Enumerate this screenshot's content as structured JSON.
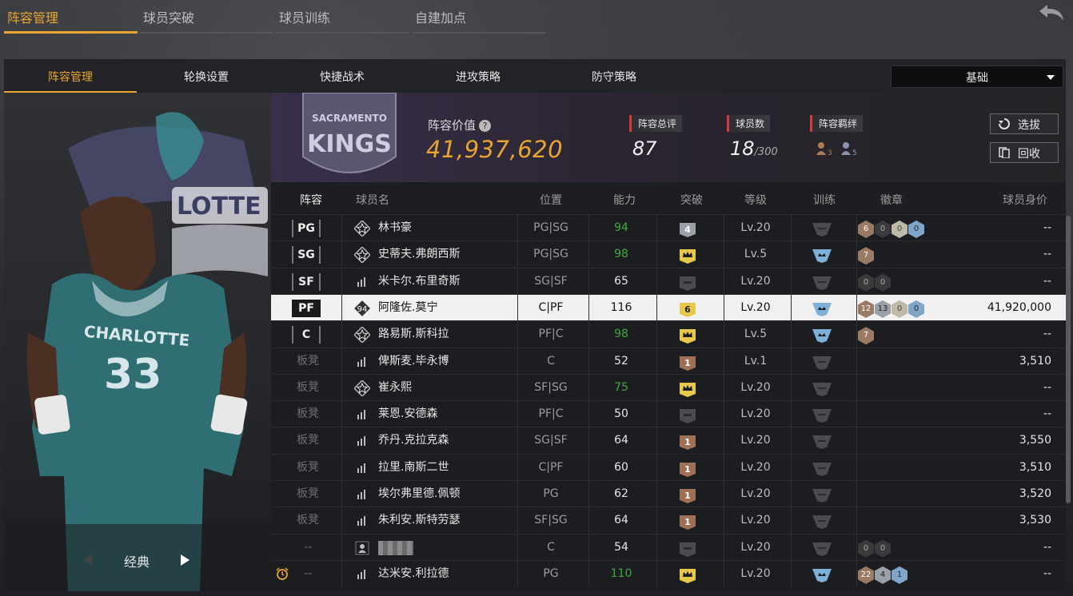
{
  "top_tabs": [
    {
      "label": "阵容管理",
      "active": true
    },
    {
      "label": "球员突破",
      "active": false
    },
    {
      "label": "球员训练",
      "active": false
    },
    {
      "label": "自建加点",
      "active": false
    }
  ],
  "sub_tabs": [
    {
      "label": "阵容管理",
      "active": true
    },
    {
      "label": "轮换设置",
      "active": false
    },
    {
      "label": "快捷战术",
      "active": false
    },
    {
      "label": "进攻策略",
      "active": false
    },
    {
      "label": "防守策略",
      "active": false
    }
  ],
  "dropdown": {
    "selected": "基础"
  },
  "portrait": {
    "style_label": "经典"
  },
  "team": {
    "logo_text_top": "SACRAMENTO",
    "logo_text_main": "KINGS",
    "value_label": "阵容价值",
    "value": "41,937,620",
    "rating_label": "阵容总评",
    "rating": "87",
    "players_label": "球员数",
    "players": "18",
    "players_max": "/300",
    "bond_label": "阵容羁绊",
    "bond_counts": [
      "3",
      "5"
    ],
    "pick_button": "选拔",
    "recycle_button": "回收"
  },
  "table": {
    "headers": [
      "阵容",
      "球员名",
      "位置",
      "能力",
      "突破",
      "等级",
      "训练",
      "徽章",
      "球员身价"
    ],
    "rows": [
      {
        "slot": "PG",
        "slot_type": "starter",
        "icon": "star",
        "name": "林书豪",
        "pos": "PG|SG",
        "ability": "94",
        "ability_green": true,
        "break": "4",
        "break_type": "silver",
        "level": "Lv.20",
        "train": "gray",
        "badges": [
          {
            "n": "6",
            "c": "bronze"
          },
          {
            "n": "0",
            "c": "empty"
          },
          {
            "n": "0",
            "c": "gold"
          },
          {
            "n": "0",
            "c": "blue"
          }
        ],
        "price": "--",
        "selected": false
      },
      {
        "slot": "SG",
        "slot_type": "starter",
        "icon": "star",
        "name": "史蒂夫.弗朗西斯",
        "pos": "PG|SG",
        "ability": "98",
        "ability_green": true,
        "break": "",
        "break_type": "crown",
        "level": "Lv.5",
        "train": "blue",
        "badges": [
          {
            "n": "7",
            "c": "bronze"
          }
        ],
        "price": "--",
        "selected": false
      },
      {
        "slot": "SF",
        "slot_type": "starter",
        "icon": "bars",
        "name": "米卡尔.布里奇斯",
        "pos": "SG|SF",
        "ability": "65",
        "ability_green": false,
        "break": "",
        "break_type": "none",
        "level": "Lv.20",
        "train": "gray",
        "badges": [
          {
            "n": "0",
            "c": "empty"
          },
          {
            "n": "0",
            "c": "empty"
          }
        ],
        "price": "--",
        "selected": false
      },
      {
        "slot": "PF",
        "slot_type": "starter",
        "icon": "94",
        "name": "阿隆佐.莫宁",
        "pos": "C|PF",
        "ability": "116",
        "ability_green": false,
        "break": "6",
        "break_type": "gold",
        "level": "Lv.20",
        "train": "blue",
        "badges": [
          {
            "n": "12",
            "c": "bronze"
          },
          {
            "n": "13",
            "c": "silver"
          },
          {
            "n": "0",
            "c": "gold"
          },
          {
            "n": "0",
            "c": "blue"
          }
        ],
        "price": "41,920,000",
        "selected": true
      },
      {
        "slot": "C",
        "slot_type": "starter",
        "icon": "star",
        "name": "路易斯.斯科拉",
        "pos": "PF|C",
        "ability": "98",
        "ability_green": true,
        "break": "",
        "break_type": "crown",
        "level": "Lv.5",
        "train": "blue",
        "badges": [
          {
            "n": "7",
            "c": "bronze"
          }
        ],
        "price": "--",
        "selected": false
      },
      {
        "slot": "板凳",
        "slot_type": "bench",
        "icon": "bars",
        "name": "俾斯麦.毕永博",
        "pos": "C",
        "ability": "52",
        "ability_green": false,
        "break": "1",
        "break_type": "bronze",
        "level": "Lv.1",
        "train": "gray",
        "badges": [],
        "price": "3,510",
        "selected": false
      },
      {
        "slot": "板凳",
        "slot_type": "bench",
        "icon": "star",
        "name": "崔永熙",
        "pos": "SF|SG",
        "ability": "75",
        "ability_green": true,
        "break": "",
        "break_type": "crown",
        "level": "Lv.20",
        "train": "gray",
        "badges": [],
        "price": "--",
        "selected": false
      },
      {
        "slot": "板凳",
        "slot_type": "bench",
        "icon": "bars",
        "name": "莱恩.安德森",
        "pos": "PF|C",
        "ability": "50",
        "ability_green": false,
        "break": "",
        "break_type": "none",
        "level": "Lv.20",
        "train": "gray",
        "badges": [],
        "price": "--",
        "selected": false
      },
      {
        "slot": "板凳",
        "slot_type": "bench",
        "icon": "bars",
        "name": "乔丹.克拉克森",
        "pos": "SG|SF",
        "ability": "64",
        "ability_green": false,
        "break": "1",
        "break_type": "bronze",
        "level": "Lv.20",
        "train": "gray",
        "badges": [],
        "price": "3,550",
        "selected": false
      },
      {
        "slot": "板凳",
        "slot_type": "bench",
        "icon": "bars",
        "name": "拉里.南斯二世",
        "pos": "C|PF",
        "ability": "60",
        "ability_green": false,
        "break": "1",
        "break_type": "bronze",
        "level": "Lv.20",
        "train": "gray",
        "badges": [],
        "price": "3,510",
        "selected": false
      },
      {
        "slot": "板凳",
        "slot_type": "bench",
        "icon": "bars",
        "name": "埃尔弗里德.佩顿",
        "pos": "PG",
        "ability": "62",
        "ability_green": false,
        "break": "1",
        "break_type": "bronze",
        "level": "Lv.20",
        "train": "gray",
        "badges": [],
        "price": "3,520",
        "selected": false
      },
      {
        "slot": "板凳",
        "slot_type": "bench",
        "icon": "bars",
        "name": "朱利安.斯特劳瑟",
        "pos": "SF|SG",
        "ability": "64",
        "ability_green": false,
        "break": "1",
        "break_type": "bronze",
        "level": "Lv.20",
        "train": "gray",
        "badges": [],
        "price": "3,530",
        "selected": false
      },
      {
        "slot": "--",
        "slot_type": "none",
        "icon": "person",
        "name": "",
        "pos": "C",
        "ability": "54",
        "ability_green": false,
        "break": "",
        "break_type": "none",
        "level": "Lv.20",
        "train": "gray",
        "badges": [
          {
            "n": "0",
            "c": "empty"
          },
          {
            "n": "0",
            "c": "empty"
          }
        ],
        "price": "--",
        "selected": false
      },
      {
        "slot": "--",
        "slot_type": "none",
        "icon": "bars",
        "name": "达米安.利拉德",
        "pos": "PG",
        "ability": "110",
        "ability_green": true,
        "break": "",
        "break_type": "crown",
        "level": "Lv.20",
        "train": "blue",
        "badges": [
          {
            "n": "22",
            "c": "bronze"
          },
          {
            "n": "4",
            "c": "silver"
          },
          {
            "n": "1",
            "c": "blue"
          }
        ],
        "price": "--",
        "selected": false,
        "alarm": true
      }
    ]
  },
  "colors": {
    "accent": "#e8a531",
    "green": "#3ea93e",
    "selected_row": "#f1f1f1"
  }
}
